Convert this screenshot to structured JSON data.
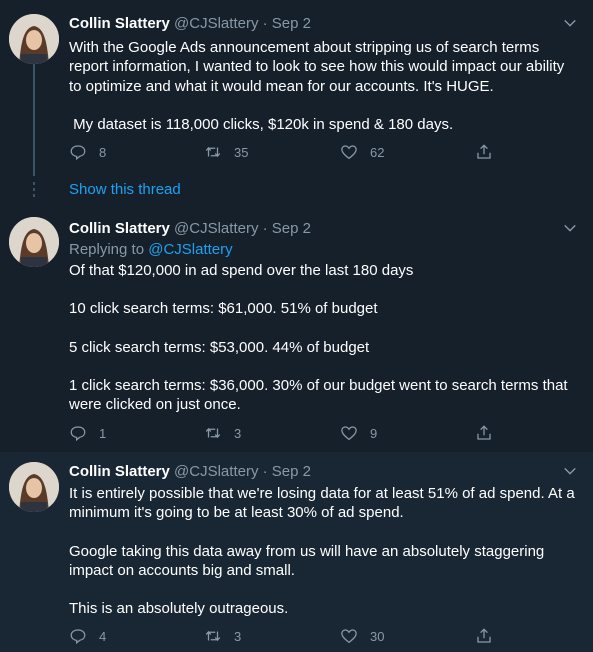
{
  "tweets": [
    {
      "name": "Collin Slattery",
      "handle": "@CJSlattery",
      "separator": "·",
      "date": "Sep 2",
      "reply_prefix": "",
      "reply_handle": "",
      "paragraphs": [
        "With the Google Ads announcement about stripping us of search terms report information, I wanted to look to see how this would impact our ability to optimize and what it would mean for our accounts. It's HUGE.",
        " My dataset is 118,000 clicks, $120k in spend & 180 days."
      ],
      "replies": "8",
      "retweets": "35",
      "likes": "62"
    },
    {
      "name": "Collin Slattery",
      "handle": "@CJSlattery",
      "separator": "·",
      "date": "Sep 2",
      "reply_prefix": "Replying to ",
      "reply_handle": "@CJSlattery",
      "paragraphs": [
        "Of that $120,000 in ad spend over the last 180 days",
        "10 click search terms: $61,000. 51% of budget",
        "5 click search terms: $53,000. 44% of budget",
        "1 click search terms: $36,000. 30% of our budget went to search terms that were clicked on just once."
      ],
      "replies": "1",
      "retweets": "3",
      "likes": "9"
    },
    {
      "name": "Collin Slattery",
      "handle": "@CJSlattery",
      "separator": "·",
      "date": "Sep 2",
      "reply_prefix": "",
      "reply_handle": "",
      "paragraphs": [
        "It is entirely possible that we're losing data for at least 51% of ad spend. At a minimum it's going to be at least 30% of ad spend.",
        "Google taking this data away from us will have an absolutely staggering impact on accounts big and small.",
        "This is an absolutely outrageous."
      ],
      "replies": "4",
      "retweets": "3",
      "likes": "30"
    }
  ],
  "show_thread_label": "Show this thread",
  "icons": {
    "reply": "reply-icon",
    "retweet": "retweet-icon",
    "like": "like-icon",
    "share": "share-icon",
    "caret": "chevron-down-icon"
  },
  "colors": {
    "background": "#15202b",
    "highlight_background": "#192734",
    "text": "#ffffff",
    "muted": "#8899a6",
    "link": "#1da1f2",
    "thread_line": "#3d5466"
  }
}
